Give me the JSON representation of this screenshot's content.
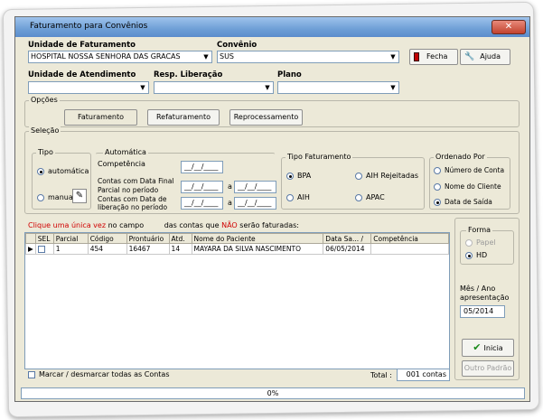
{
  "window": {
    "title": "Faturamento para Convênios",
    "close_label": "✕"
  },
  "top": {
    "unidade_faturamento_label": "Unidade de Faturamento",
    "unidade_faturamento_value": "HOSPITAL NOSSA SENHORA DAS GRACAS",
    "convenio_label": "Convênio",
    "convenio_value": "SUS",
    "fecha_label": "Fecha",
    "ajuda_label": "Ajuda",
    "unidade_atendimento_label": "Unidade de Atendimento",
    "unidade_atendimento_value": "",
    "resp_liberacao_label": "Resp. Liberação",
    "resp_liberacao_value": "",
    "plano_label": "Plano",
    "plano_value": ""
  },
  "opcoes": {
    "title": "Opções",
    "buttons": [
      "Faturamento",
      "Refaturamento",
      "Reprocessamento"
    ]
  },
  "selecao": {
    "title": "Seleção",
    "tipo": {
      "title": "Tipo",
      "automatica": "automática",
      "manual": "manual",
      "selected": "automática"
    },
    "automatica": {
      "title": "Automática",
      "competencia_label": "Competência",
      "competencia_value": "__/__/____",
      "parcial_label_1": "Contas com Data Final",
      "parcial_label_2": "Parcial no período",
      "parcial_from": "__/__/____",
      "parcial_to": "__/__/____",
      "liberacao_label_1": "Contas com Data de",
      "liberacao_label_2": "liberação no período",
      "liberacao_from": "__/__/____",
      "liberacao_to": "__/__/____",
      "sep": "a"
    },
    "tipo_faturamento": {
      "title": "Tipo Faturamento",
      "options": [
        "BPA",
        "AIH Rejeitadas",
        "AIH",
        "APAC"
      ],
      "selected": "BPA"
    },
    "ordenado_por": {
      "title": "Ordenado Por",
      "options": [
        "Número de Conta",
        "Nome do Cliente",
        "Data de Saída"
      ],
      "selected": "Data de Saída"
    }
  },
  "instruction": {
    "part1": "Clique uma única vez",
    "part2": "no campo",
    "part3": "das contas que",
    "part4": "NÃO",
    "part5": "serão faturadas:"
  },
  "grid": {
    "columns": [
      "SEL",
      "Parcial",
      "Código",
      "Prontuário",
      "Atd.",
      "Nome do Paciente",
      "Data Sa... /",
      "Competência"
    ],
    "rows": [
      {
        "sel": "",
        "parcial": "1",
        "codigo": "454",
        "prontuario": "16467",
        "atd": "14",
        "nome": "MAYARA DA SILVA NASCIMENTO",
        "data_saida": "06/05/2014",
        "competencia": ""
      }
    ]
  },
  "forma": {
    "title": "Forma",
    "options": [
      "Papel",
      "HD"
    ],
    "selected": "HD"
  },
  "mes_ano": {
    "label_1": "Mês / Ano",
    "label_2": "apresentação",
    "value": "05/2014"
  },
  "actions": {
    "inicia_label": "Inicia",
    "outro_padrao_label": "Outro Padrão"
  },
  "footer": {
    "marcar_label": "Marcar / desmarcar todas as Contas",
    "total_label": "Total :",
    "total_value": "001 contas",
    "progress": "0%"
  }
}
